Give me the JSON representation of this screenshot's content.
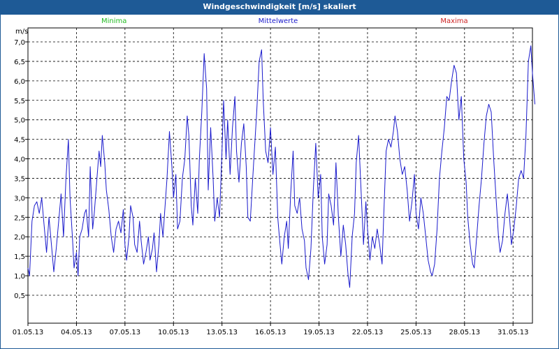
{
  "window": {
    "title": "Windgeschwindigkeit [m/s] skaliert"
  },
  "legend": {
    "min_label": "Minima",
    "min_color": "#22bb22",
    "mean_label": "Mittelwerte",
    "mean_color": "#1a1acc",
    "max_label": "Maxima",
    "max_color": "#cc2222"
  },
  "chart_data": {
    "type": "line",
    "title": "Windgeschwindigkeit [m/s] skaliert",
    "ylabel": "m/s",
    "xlabel": "",
    "ylim": [
      0.4,
      7.2
    ],
    "xlim": [
      0,
      32
    ],
    "grid": true,
    "legend_placement": "top",
    "yticks": [
      "0,5",
      "1,0",
      "1,5",
      "2,0",
      "2,5",
      "3,0",
      "3,5",
      "4,0",
      "4,5",
      "5,0",
      "5,5",
      "6,0",
      "6,5",
      "7,0"
    ],
    "xticks": [
      "01.05.13",
      "04.05.13",
      "07.05.13",
      "10.05.13",
      "13.05.13",
      "16.05.13",
      "19.05.13",
      "22.05.13",
      "25.05.13",
      "28.05.13",
      "31.05.13"
    ],
    "x_unit": "days since 01.05.13",
    "series": [
      {
        "name": "Mittelwerte",
        "color": "#1a1acc",
        "points": [
          [
            0.0,
            1.2
          ],
          [
            0.1,
            1.0
          ],
          [
            0.25,
            2.4
          ],
          [
            0.4,
            2.8
          ],
          [
            0.55,
            2.9
          ],
          [
            0.7,
            2.6
          ],
          [
            0.85,
            3.0
          ],
          [
            1.0,
            2.3
          ],
          [
            1.15,
            1.6
          ],
          [
            1.3,
            2.5
          ],
          [
            1.45,
            1.8
          ],
          [
            1.6,
            1.1
          ],
          [
            1.75,
            1.7
          ],
          [
            1.9,
            2.4
          ],
          [
            2.05,
            3.1
          ],
          [
            2.2,
            2.0
          ],
          [
            2.35,
            3.5
          ],
          [
            2.5,
            4.5
          ],
          [
            2.6,
            3.0
          ],
          [
            2.75,
            2.0
          ],
          [
            2.85,
            1.2
          ],
          [
            3.0,
            1.6
          ],
          [
            3.1,
            1.0
          ],
          [
            3.2,
            2.0
          ],
          [
            3.35,
            2.2
          ],
          [
            3.5,
            2.6
          ],
          [
            3.6,
            2.7
          ],
          [
            3.75,
            2.0
          ],
          [
            3.85,
            3.8
          ],
          [
            4.0,
            2.2
          ],
          [
            4.1,
            2.6
          ],
          [
            4.25,
            3.4
          ],
          [
            4.4,
            4.2
          ],
          [
            4.5,
            3.8
          ],
          [
            4.6,
            4.6
          ],
          [
            4.75,
            3.9
          ],
          [
            4.85,
            3.2
          ],
          [
            5.0,
            2.7
          ],
          [
            5.15,
            2.0
          ],
          [
            5.3,
            1.6
          ],
          [
            5.45,
            2.2
          ],
          [
            5.6,
            2.4
          ],
          [
            5.75,
            2.1
          ],
          [
            5.9,
            2.7
          ],
          [
            6.0,
            1.8
          ],
          [
            6.1,
            1.4
          ],
          [
            6.25,
            2.0
          ],
          [
            6.35,
            2.8
          ],
          [
            6.5,
            2.5
          ],
          [
            6.6,
            1.8
          ],
          [
            6.75,
            1.6
          ],
          [
            6.9,
            2.4
          ],
          [
            7.0,
            1.9
          ],
          [
            7.15,
            1.3
          ],
          [
            7.3,
            1.6
          ],
          [
            7.45,
            2.0
          ],
          [
            7.55,
            1.4
          ],
          [
            7.7,
            1.7
          ],
          [
            7.8,
            2.1
          ],
          [
            7.95,
            1.1
          ],
          [
            8.1,
            1.8
          ],
          [
            8.2,
            2.6
          ],
          [
            8.35,
            2.0
          ],
          [
            8.45,
            2.6
          ],
          [
            8.6,
            3.5
          ],
          [
            8.75,
            4.7
          ],
          [
            8.9,
            3.8
          ],
          [
            9.0,
            3.0
          ],
          [
            9.15,
            3.6
          ],
          [
            9.25,
            2.2
          ],
          [
            9.4,
            2.4
          ],
          [
            9.55,
            3.5
          ],
          [
            9.7,
            4.0
          ],
          [
            9.85,
            5.1
          ],
          [
            9.95,
            4.6
          ],
          [
            10.1,
            2.8
          ],
          [
            10.2,
            2.3
          ],
          [
            10.35,
            3.5
          ],
          [
            10.5,
            2.6
          ],
          [
            10.6,
            4.0
          ],
          [
            10.75,
            5.2
          ],
          [
            10.9,
            6.7
          ],
          [
            11.05,
            5.8
          ],
          [
            11.15,
            3.2
          ],
          [
            11.3,
            4.8
          ],
          [
            11.45,
            3.5
          ],
          [
            11.55,
            2.4
          ],
          [
            11.7,
            3.0
          ],
          [
            11.85,
            2.5
          ],
          [
            12.0,
            4.2
          ],
          [
            12.1,
            5.5
          ],
          [
            12.25,
            4.0
          ],
          [
            12.35,
            5.0
          ],
          [
            12.5,
            3.6
          ],
          [
            12.65,
            4.8
          ],
          [
            12.8,
            5.6
          ],
          [
            12.9,
            4.2
          ],
          [
            13.05,
            3.4
          ],
          [
            13.2,
            4.4
          ],
          [
            13.35,
            4.9
          ],
          [
            13.5,
            3.8
          ],
          [
            13.6,
            2.5
          ],
          [
            13.75,
            2.4
          ],
          [
            13.9,
            3.5
          ],
          [
            14.0,
            4.2
          ],
          [
            14.15,
            5.2
          ],
          [
            14.3,
            6.5
          ],
          [
            14.45,
            6.8
          ],
          [
            14.55,
            5.5
          ],
          [
            14.7,
            4.2
          ],
          [
            14.85,
            3.9
          ],
          [
            15.0,
            4.8
          ],
          [
            15.15,
            3.6
          ],
          [
            15.3,
            4.3
          ],
          [
            15.45,
            2.5
          ],
          [
            15.55,
            2.0
          ],
          [
            15.7,
            1.3
          ],
          [
            15.85,
            2.0
          ],
          [
            16.0,
            2.4
          ],
          [
            16.1,
            1.7
          ],
          [
            16.25,
            3.1
          ],
          [
            16.4,
            4.2
          ],
          [
            16.5,
            2.8
          ],
          [
            16.65,
            2.6
          ],
          [
            16.8,
            3.0
          ],
          [
            16.95,
            2.2
          ],
          [
            17.1,
            1.9
          ],
          [
            17.2,
            1.2
          ],
          [
            17.35,
            0.9
          ],
          [
            17.5,
            1.7
          ],
          [
            17.65,
            3.2
          ],
          [
            17.8,
            4.4
          ],
          [
            17.95,
            3.0
          ],
          [
            18.1,
            3.6
          ],
          [
            18.2,
            2.0
          ],
          [
            18.35,
            1.3
          ],
          [
            18.5,
            1.8
          ],
          [
            18.6,
            3.1
          ],
          [
            18.75,
            2.8
          ],
          [
            18.9,
            2.3
          ],
          [
            19.05,
            3.9
          ],
          [
            19.2,
            2.5
          ],
          [
            19.35,
            1.5
          ],
          [
            19.5,
            2.3
          ],
          [
            19.65,
            1.8
          ],
          [
            19.8,
            1.0
          ],
          [
            19.9,
            0.7
          ],
          [
            20.05,
            2.0
          ],
          [
            20.2,
            2.6
          ],
          [
            20.3,
            3.9
          ],
          [
            20.45,
            4.6
          ],
          [
            20.6,
            3.2
          ],
          [
            20.75,
            1.8
          ],
          [
            20.9,
            2.9
          ],
          [
            21.0,
            2.2
          ],
          [
            21.15,
            1.4
          ],
          [
            21.3,
            2.0
          ],
          [
            21.45,
            1.7
          ],
          [
            21.6,
            2.2
          ],
          [
            21.75,
            1.8
          ],
          [
            21.9,
            1.3
          ],
          [
            22.0,
            2.5
          ],
          [
            22.15,
            4.2
          ],
          [
            22.3,
            4.5
          ],
          [
            22.45,
            4.3
          ],
          [
            22.6,
            4.7
          ],
          [
            22.7,
            5.1
          ],
          [
            22.85,
            4.7
          ],
          [
            23.0,
            4.0
          ],
          [
            23.15,
            3.6
          ],
          [
            23.3,
            3.8
          ],
          [
            23.45,
            3.2
          ],
          [
            23.6,
            2.4
          ],
          [
            23.75,
            2.9
          ],
          [
            23.9,
            3.6
          ],
          [
            24.0,
            2.6
          ],
          [
            24.15,
            2.2
          ],
          [
            24.3,
            3.0
          ],
          [
            24.45,
            2.6
          ],
          [
            24.6,
            2.0
          ],
          [
            24.75,
            1.4
          ],
          [
            24.9,
            1.1
          ],
          [
            25.0,
            1.0
          ],
          [
            25.15,
            1.3
          ],
          [
            25.3,
            2.2
          ],
          [
            25.45,
            3.5
          ],
          [
            25.6,
            4.2
          ],
          [
            25.75,
            4.8
          ],
          [
            25.9,
            5.6
          ],
          [
            26.05,
            5.5
          ],
          [
            26.2,
            6.0
          ],
          [
            26.35,
            6.4
          ],
          [
            26.5,
            6.2
          ],
          [
            26.65,
            5.0
          ],
          [
            26.8,
            5.6
          ],
          [
            26.95,
            4.0
          ],
          [
            27.1,
            3.4
          ],
          [
            27.2,
            2.5
          ],
          [
            27.35,
            1.8
          ],
          [
            27.5,
            1.3
          ],
          [
            27.6,
            1.2
          ],
          [
            27.75,
            2.0
          ],
          [
            27.9,
            2.8
          ],
          [
            28.05,
            3.5
          ],
          [
            28.2,
            4.4
          ],
          [
            28.35,
            5.1
          ],
          [
            28.5,
            5.4
          ],
          [
            28.65,
            5.2
          ],
          [
            28.8,
            4.0
          ],
          [
            28.95,
            3.0
          ],
          [
            29.1,
            2.0
          ],
          [
            29.2,
            1.6
          ],
          [
            29.35,
            1.9
          ],
          [
            29.5,
            2.6
          ],
          [
            29.65,
            3.1
          ],
          [
            29.8,
            2.4
          ],
          [
            29.9,
            1.8
          ],
          [
            30.05,
            2.2
          ],
          [
            30.2,
            2.8
          ],
          [
            30.35,
            3.5
          ],
          [
            30.5,
            3.7
          ],
          [
            30.65,
            3.5
          ],
          [
            30.8,
            4.6
          ],
          [
            30.95,
            6.5
          ],
          [
            31.1,
            6.9
          ],
          [
            31.2,
            6.2
          ],
          [
            31.35,
            5.4
          ]
        ]
      }
    ]
  }
}
